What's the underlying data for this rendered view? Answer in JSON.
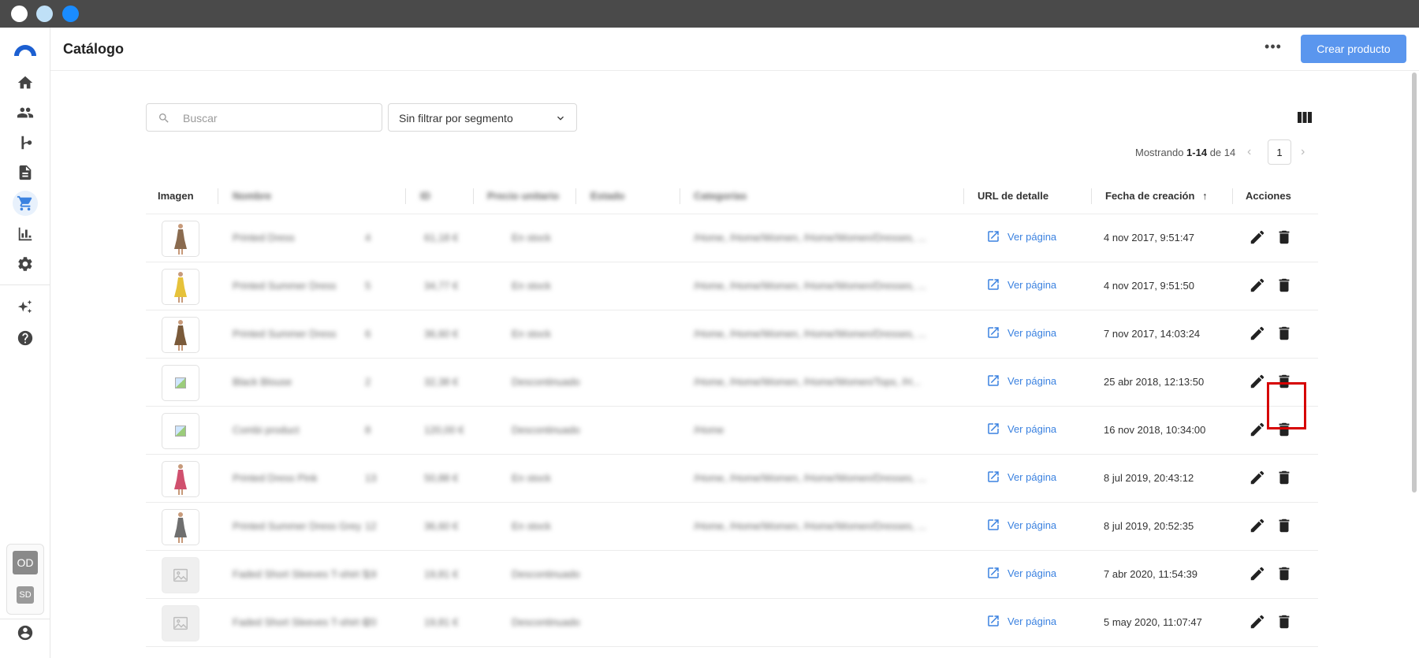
{
  "window": {
    "dots": [
      "#ffffff",
      "#bfe0f7",
      "#1a8cff"
    ]
  },
  "sidebar": {
    "items": [
      {
        "icon": "home-icon"
      },
      {
        "icon": "people-icon"
      },
      {
        "icon": "flow-icon"
      },
      {
        "icon": "document-icon"
      },
      {
        "icon": "cart-icon",
        "active": true
      },
      {
        "icon": "bar-chart-icon"
      },
      {
        "icon": "gear-icon"
      },
      {
        "icon": "sparkle-icon"
      },
      {
        "icon": "help-icon"
      }
    ],
    "avatar_primary": "OD",
    "avatar_secondary": "SD",
    "accent": "#3b82e0"
  },
  "header": {
    "title": "Catálogo",
    "more_label": "•••",
    "create_label": "Crear producto"
  },
  "filters": {
    "search_placeholder": "Buscar",
    "segment_value": "Sin filtrar por segmento"
  },
  "pagination": {
    "prefix": "Mostrando ",
    "range": "1-14",
    "suffix": " de 14",
    "page": "1"
  },
  "table": {
    "columns": {
      "imagen": "Imagen",
      "nombre": "Nombre",
      "id": "ID",
      "precio": "Precio unitario",
      "estado": "Estado",
      "categorias": "Categorías",
      "url": "URL de detalle",
      "fecha": "Fecha de creación",
      "acciones": "Acciones"
    },
    "rows": [
      {
        "image": "photo",
        "name": "Printed Dress",
        "id": "4",
        "price": "61,18 €",
        "status": "En stock",
        "categories": "/Home, /Home/Women, /Home/Women/Dresses, ...",
        "link": "Ver página",
        "date": "4 nov 2017, 9:51:47"
      },
      {
        "image": "photo",
        "name": "Printed Summer Dress",
        "id": "5",
        "price": "34,77 €",
        "status": "En stock",
        "categories": "/Home, /Home/Women, /Home/Women/Dresses, ...",
        "link": "Ver página",
        "date": "4 nov 2017, 9:51:50"
      },
      {
        "image": "photo",
        "name": "Printed Summer Dress",
        "id": "6",
        "price": "36,60 €",
        "status": "En stock",
        "categories": "/Home, /Home/Women, /Home/Women/Dresses, ...",
        "link": "Ver página",
        "date": "7 nov 2017, 14:03:24"
      },
      {
        "image": "broken",
        "name": "Black Blouse",
        "id": "2",
        "price": "32,38 €",
        "status": "Descontinuado",
        "categories": "/Home, /Home/Women, /Home/Women/Tops, /H...",
        "link": "Ver página",
        "date": "25 abr 2018, 12:13:50"
      },
      {
        "image": "broken",
        "name": "Combi product",
        "id": "8",
        "price": "120,00 €",
        "status": "Descontinuado",
        "categories": "/Home",
        "link": "Ver página",
        "date": "16 nov 2018, 10:34:00"
      },
      {
        "image": "photo",
        "name": "Printed Dress Pink",
        "id": "13",
        "price": "50,88 €",
        "status": "En stock",
        "categories": "/Home, /Home/Women, /Home/Women/Dresses, ...",
        "link": "Ver página",
        "date": "8 jul 2019, 20:43:12"
      },
      {
        "image": "photo",
        "name": "Printed Summer Dress Grey",
        "id": "12",
        "price": "36,60 €",
        "status": "En stock",
        "categories": "/Home, /Home/Women, /Home/Women/Dresses, ...",
        "link": "Ver página",
        "date": "8 jul 2019, 20:52:35"
      },
      {
        "image": "placeholder",
        "name": "Faded Short Sleeves T-shirt 5",
        "id": "19",
        "price": "19,81 €",
        "status": "Descontinuado",
        "categories": "",
        "link": "Ver página",
        "date": "7 abr 2020, 11:54:39"
      },
      {
        "image": "placeholder",
        "name": "Faded Short Sleeves T-shirt 6",
        "id": "20",
        "price": "19,81 €",
        "status": "Descontinuado",
        "categories": "",
        "link": "Ver página",
        "date": "5 may 2020, 11:07:47"
      }
    ]
  }
}
